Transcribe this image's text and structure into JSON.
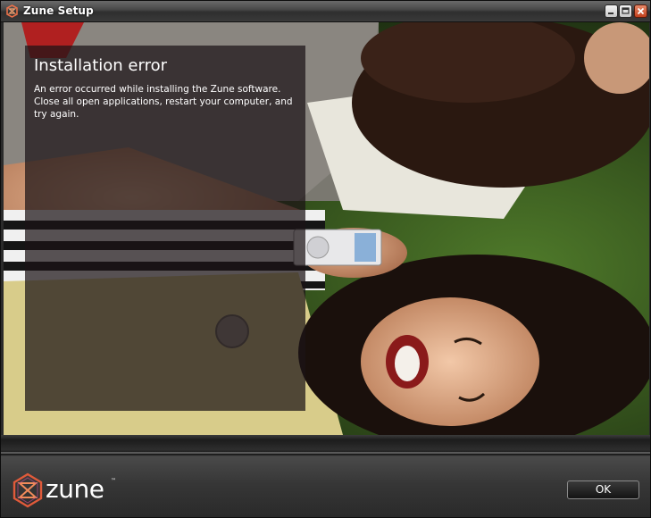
{
  "window": {
    "title": "Zune Setup",
    "title_icon": "zune-icon",
    "controls": [
      "minimize-icon",
      "maximize-icon",
      "close-icon"
    ]
  },
  "error_panel": {
    "title": "Installation error",
    "message": "An error occurred while installing the Zune software. Close all open applications, restart your computer, and try again."
  },
  "footer": {
    "brand": "zune",
    "trademark": "™",
    "ok_label": "OK"
  },
  "colors": {
    "close_button": "#c0401c",
    "logo_accent": "#e05a3a"
  }
}
